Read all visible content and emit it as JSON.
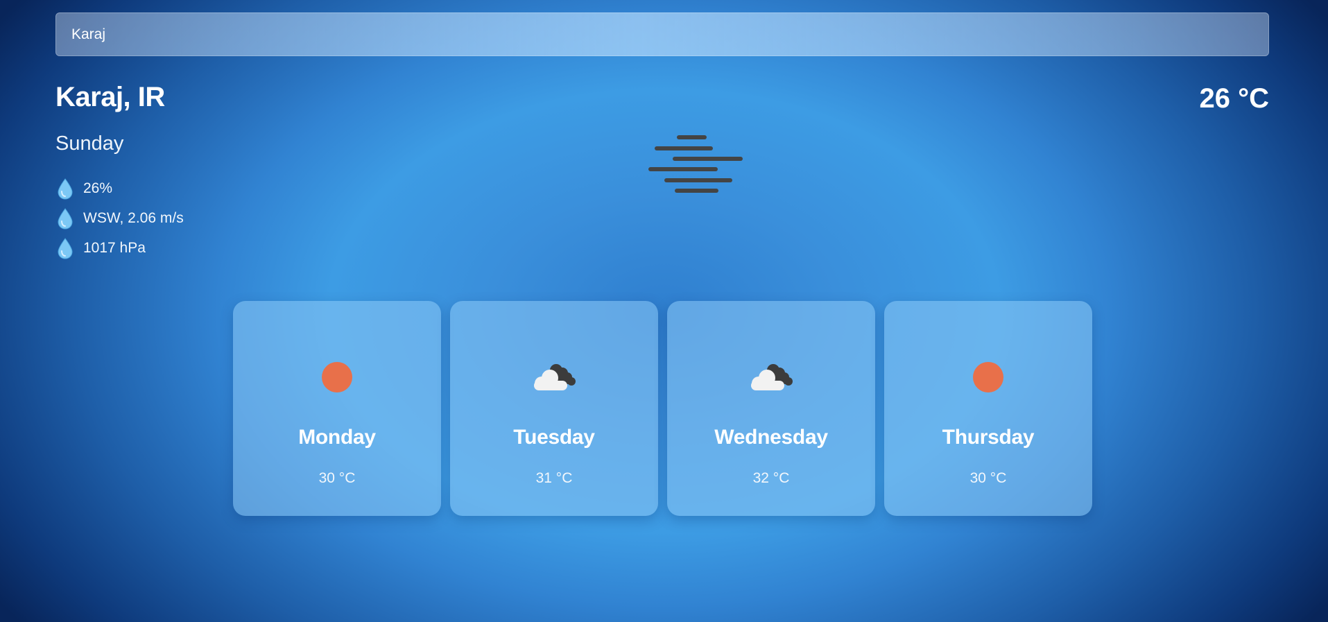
{
  "search": {
    "value": "Karaj"
  },
  "current": {
    "city": "Karaj, IR",
    "temperature": "26 °C",
    "day": "Sunday",
    "condition_icon": "mist-icon",
    "details": [
      {
        "icon": "water-drop-icon",
        "text": "26%"
      },
      {
        "icon": "water-drop-icon",
        "text": "WSW, 2.06 m/s"
      },
      {
        "icon": "water-drop-icon",
        "text": "1017 hPa"
      }
    ]
  },
  "forecast": [
    {
      "day": "Monday",
      "temp": "30 °C",
      "icon": "sun-icon"
    },
    {
      "day": "Tuesday",
      "temp": "31 °C",
      "icon": "cloudy-icon"
    },
    {
      "day": "Wednesday",
      "temp": "32 °C",
      "icon": "cloudy-icon"
    },
    {
      "day": "Thursday",
      "temp": "30 °C",
      "icon": "sun-icon"
    }
  ],
  "colors": {
    "sun": "#e8704a",
    "cloud_light": "#f2f2f2",
    "cloud_dark": "#3c3c3c",
    "mist": "#444444",
    "drop": "#7cc8f5"
  }
}
